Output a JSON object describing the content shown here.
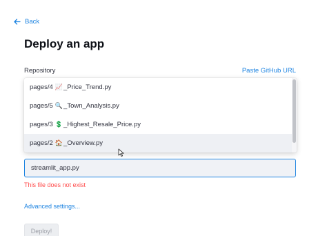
{
  "nav": {
    "back_label": "Back"
  },
  "header": {
    "title": "Deploy an app"
  },
  "repository": {
    "label": "Repository",
    "paste_link": "Paste GitHub URL"
  },
  "dropdown": {
    "options": [
      {
        "prefix": "pages/4",
        "icon": "📈",
        "suffix": "_Price_Trend.py",
        "icon_name": "chart-up-icon"
      },
      {
        "prefix": "pages/5",
        "icon": "🔍",
        "suffix": "_Town_Analysis.py",
        "icon_name": "magnifier-icon"
      },
      {
        "prefix": "pages/3",
        "icon": "💲",
        "suffix": "_Highest_Resale_Price.py",
        "icon_name": "dollar-icon"
      },
      {
        "prefix": "pages/2",
        "icon": "🏠",
        "suffix": "_Overview.py",
        "icon_name": "house-icon"
      }
    ],
    "highlighted_index": 3
  },
  "main_file": {
    "value": "streamlit_app.py",
    "error": "This file does not exist"
  },
  "advanced_link": "Advanced settings...",
  "deploy_button": "Deploy!",
  "colors": {
    "accent": "#1c83e1",
    "error": "#ff4b4b",
    "input_bg": "#f0f2f6"
  }
}
